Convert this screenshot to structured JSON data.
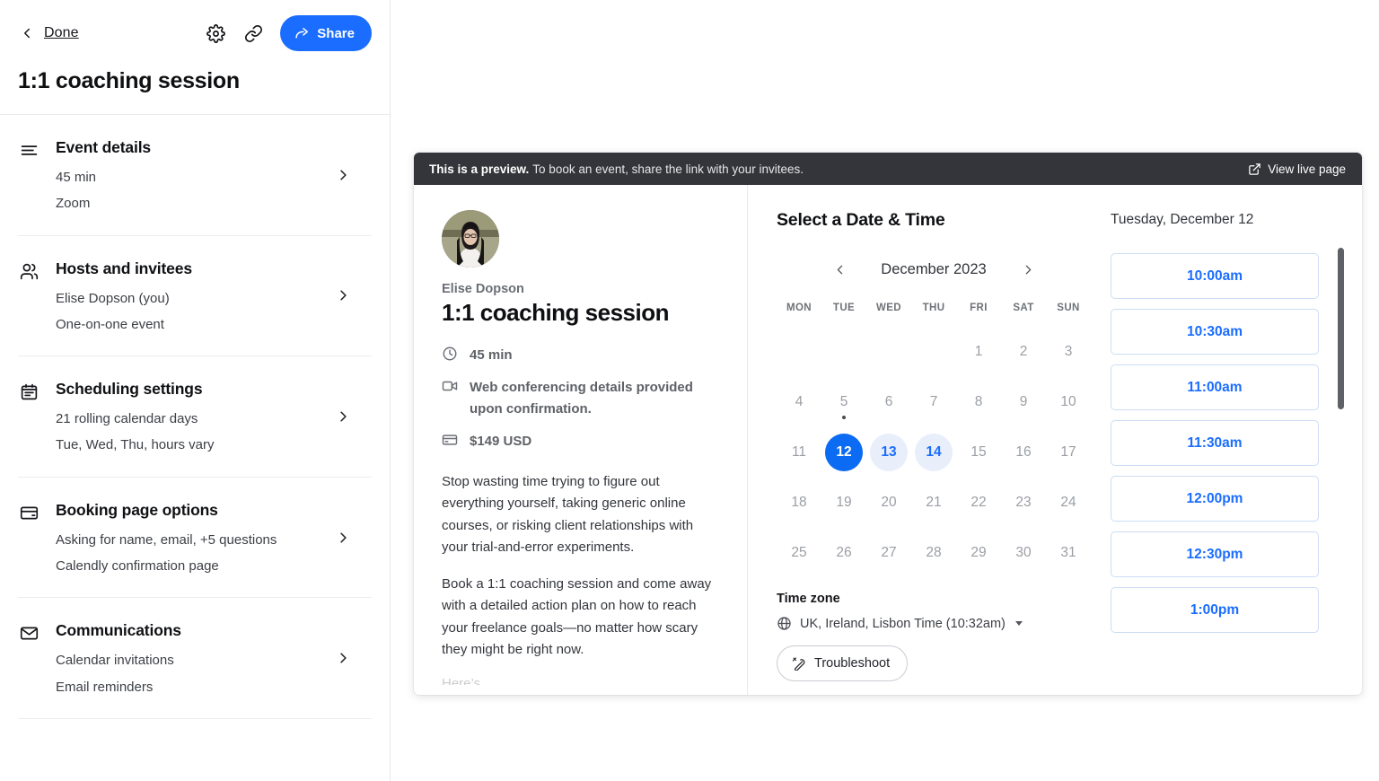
{
  "sidebar": {
    "back_label": "Done",
    "share_label": "Share",
    "event_title": "1:1 coaching session",
    "sections": [
      {
        "icon": "list-icon",
        "title": "Event details",
        "lines": [
          "45 min",
          "Zoom"
        ]
      },
      {
        "icon": "people-icon",
        "title": "Hosts and invitees",
        "lines": [
          "Elise Dopson (you)",
          "One-on-one event"
        ]
      },
      {
        "icon": "calendar-icon",
        "title": "Scheduling settings",
        "lines": [
          "21 rolling calendar days",
          "Tue, Wed, Thu, hours vary"
        ]
      },
      {
        "icon": "card-icon",
        "title": "Booking page options",
        "lines": [
          "Asking for name, email, +5 questions",
          "Calendly confirmation page"
        ]
      },
      {
        "icon": "envelope-icon",
        "title": "Communications",
        "lines": [
          "Calendar invitations",
          "Email reminders"
        ]
      }
    ]
  },
  "preview": {
    "banner_bold": "This is a preview.",
    "banner_text": "To book an event, share the link with your invitees.",
    "view_live_label": "View live page",
    "host_name": "Elise Dopson",
    "title": "1:1 coaching session",
    "meta": [
      {
        "icon": "clock-icon",
        "text": "45 min"
      },
      {
        "icon": "video-icon",
        "text": "Web conferencing details provided upon confirmation."
      },
      {
        "icon": "card-icon",
        "text": "$149 USD"
      }
    ],
    "description": [
      "Stop wasting time trying to figure out everything yourself, taking generic online courses, or risking client relationships with your trial-and-error experiments.",
      "Book a 1:1 coaching session and come away with a detailed action plan on how to reach your freelance goals—no matter how scary they might be right now."
    ],
    "clipped_line": "Here’s ..."
  },
  "scheduler": {
    "heading": "Select a Date & Time",
    "month_label": "December 2023",
    "weekdays": [
      "MON",
      "TUE",
      "WED",
      "THU",
      "FRI",
      "SAT",
      "SUN"
    ],
    "lead_blanks": 4,
    "days": [
      {
        "n": "1"
      },
      {
        "n": "2"
      },
      {
        "n": "3"
      },
      {
        "n": "4"
      },
      {
        "n": "5",
        "dot": true
      },
      {
        "n": "6"
      },
      {
        "n": "7"
      },
      {
        "n": "8"
      },
      {
        "n": "9"
      },
      {
        "n": "10"
      },
      {
        "n": "11"
      },
      {
        "n": "12",
        "state": "selected"
      },
      {
        "n": "13",
        "state": "avail"
      },
      {
        "n": "14",
        "state": "avail"
      },
      {
        "n": "15"
      },
      {
        "n": "16"
      },
      {
        "n": "17"
      },
      {
        "n": "18"
      },
      {
        "n": "19"
      },
      {
        "n": "20"
      },
      {
        "n": "21"
      },
      {
        "n": "22"
      },
      {
        "n": "23"
      },
      {
        "n": "24"
      },
      {
        "n": "25"
      },
      {
        "n": "26"
      },
      {
        "n": "27"
      },
      {
        "n": "28"
      },
      {
        "n": "29"
      },
      {
        "n": "30"
      },
      {
        "n": "31"
      }
    ],
    "timezone_label": "Time zone",
    "timezone_value": "UK, Ireland, Lisbon Time (10:32am)",
    "troubleshoot_label": "Troubleshoot",
    "selected_date_label": "Tuesday, December 12",
    "slots": [
      "10:00am",
      "10:30am",
      "11:00am",
      "11:30am",
      "12:00pm",
      "12:30pm",
      "1:00pm"
    ]
  },
  "colors": {
    "accent_blue": "#1a6dff",
    "selected_day": "#0b6bf2",
    "banner_dark": "#33353a",
    "avail_day_bg": "#e9eefb"
  }
}
